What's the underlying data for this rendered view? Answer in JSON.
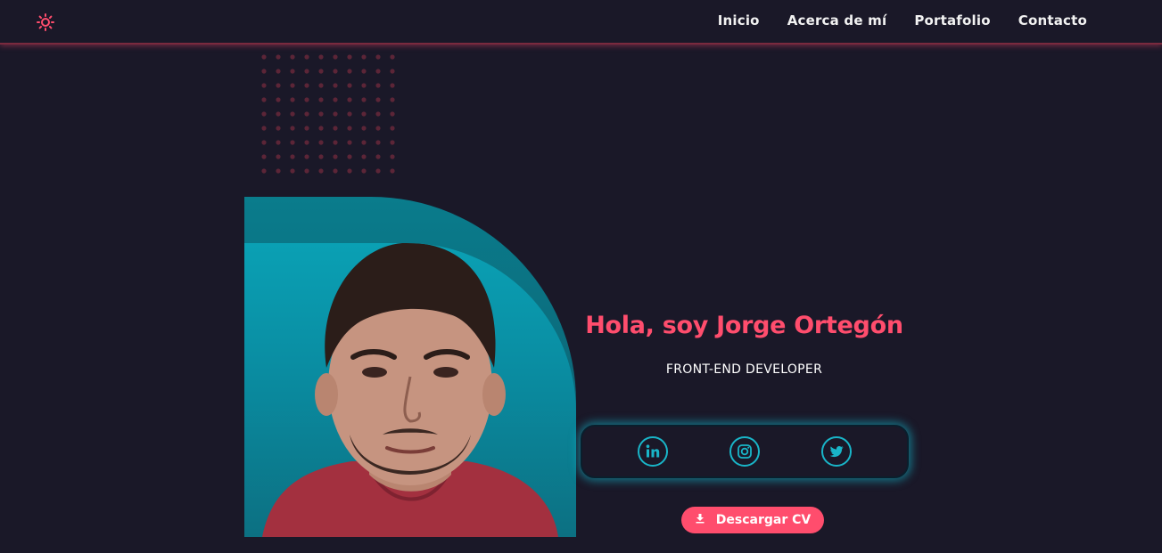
{
  "colors": {
    "background": "#1a1828",
    "accent": "#ff4d6d",
    "teal": "#19b5c8",
    "nav_text": "#f2f2f2"
  },
  "header": {
    "theme_toggle_icon": "sun-icon",
    "nav": [
      {
        "label": "Inicio"
      },
      {
        "label": "Acerca de mí"
      },
      {
        "label": "Portafolio"
      },
      {
        "label": "Contacto"
      }
    ]
  },
  "hero": {
    "title": "Hola, soy Jorge Ortegón",
    "subtitle": "FRONT-END DEVELOPER",
    "photo_icon": "profile-photo",
    "social": [
      {
        "icon": "linkedin-icon"
      },
      {
        "icon": "instagram-icon"
      },
      {
        "icon": "twitter-icon"
      }
    ],
    "cv_button": {
      "label": "Descargar CV",
      "icon": "download-icon"
    }
  }
}
